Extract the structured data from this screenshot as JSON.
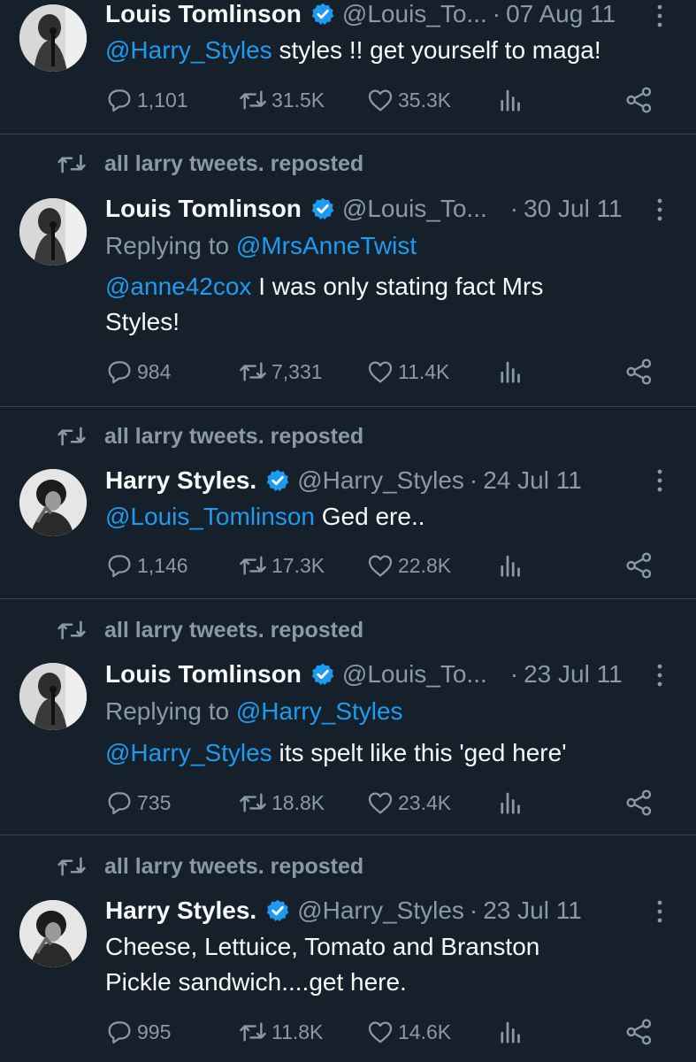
{
  "colors": {
    "background": "#15202b",
    "text": "#f7f9f9",
    "muted": "#8b98a5",
    "link": "#1d9bf0",
    "divider": "#38444d"
  },
  "tweets": [
    {
      "repost_label": "",
      "name": "Louis Tomlinson",
      "handle": "@Louis_To...",
      "date": "07 Aug 11",
      "reply_prefix": "",
      "reply_to": "",
      "mention": "@Harry_Styles",
      "text": " styles !! get yourself to maga!",
      "text_line2": "",
      "stats": {
        "replies": "1,101",
        "reposts": "31.5K",
        "likes": "35.3K"
      }
    },
    {
      "repost_label": "all larry tweets. reposted",
      "name": "Louis Tomlinson",
      "handle": "@Louis_To...",
      "date": "30 Jul 11",
      "reply_prefix": "Replying to ",
      "reply_to": "@MrsAnneTwist",
      "mention": "@anne42cox",
      "text": " I was only stating fact Mrs",
      "text_line2": "Styles!",
      "stats": {
        "replies": "984",
        "reposts": "7,331",
        "likes": "11.4K"
      }
    },
    {
      "repost_label": "all larry tweets. reposted",
      "name": "Harry Styles.",
      "handle": "@Harry_Styles",
      "date": "24 Jul 11",
      "reply_prefix": "",
      "reply_to": "",
      "mention": "@Louis_Tomlinson",
      "text": " Ged ere..",
      "text_line2": "",
      "stats": {
        "replies": "1,146",
        "reposts": "17.3K",
        "likes": "22.8K"
      }
    },
    {
      "repost_label": "all larry tweets. reposted",
      "name": "Louis Tomlinson",
      "handle": "@Louis_To...",
      "date": "23 Jul 11",
      "reply_prefix": "Replying to ",
      "reply_to": "@Harry_Styles",
      "mention": "@Harry_Styles",
      "text": " its spelt like this 'ged here'",
      "text_line2": "",
      "stats": {
        "replies": "735",
        "reposts": "18.8K",
        "likes": "23.4K"
      }
    },
    {
      "repost_label": "all larry tweets. reposted",
      "name": "Harry Styles.",
      "handle": "@Harry_Styles",
      "date": "23 Jul 11",
      "reply_prefix": "",
      "reply_to": "",
      "mention": "",
      "text": "Cheese, Lettuice, Tomato and Branston",
      "text_line2": "Pickle sandwich....get here.",
      "stats": {
        "replies": "995",
        "reposts": "11.8K",
        "likes": "14.6K"
      }
    }
  ]
}
